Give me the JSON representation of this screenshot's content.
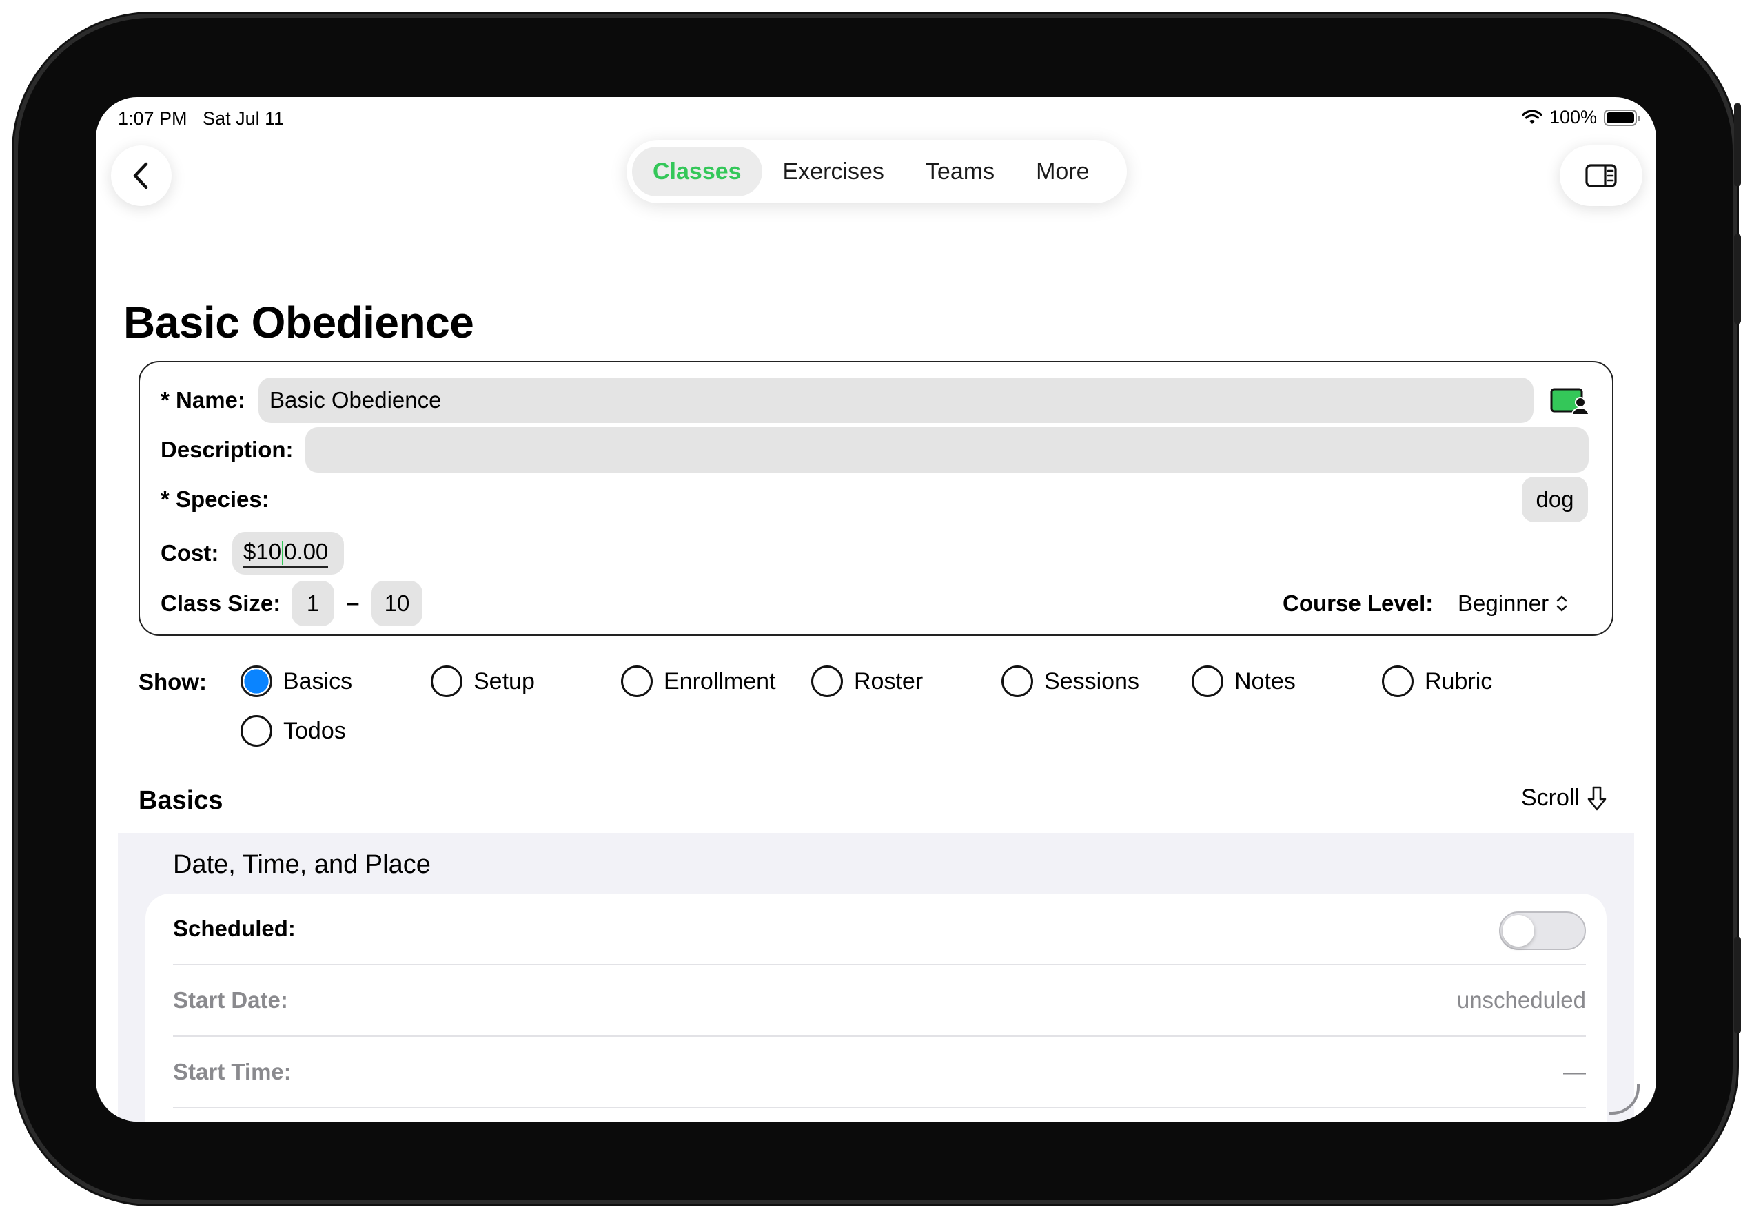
{
  "status_bar": {
    "time": "1:07 PM",
    "date": "Sat Jul 11",
    "battery_percent": "100%",
    "battery_level": 1.0
  },
  "nav": {
    "back_icon": "chevron-left-icon",
    "sidebar_icon": "sidebar-right-icon",
    "tabs": [
      {
        "label": "Classes",
        "active": true
      },
      {
        "label": "Exercises",
        "active": false
      },
      {
        "label": "Teams",
        "active": false
      },
      {
        "label": "More",
        "active": false
      }
    ],
    "accent_color": "#34c759"
  },
  "page": {
    "title": "Basic Obedience"
  },
  "form": {
    "name_label": "* Name:",
    "name_value": "Basic Obedience",
    "description_label": "Description:",
    "description_value": "",
    "species_label": "* Species:",
    "species_value": "dog",
    "cost_label": "Cost:",
    "cost_value_before_caret": "$10",
    "cost_value_after_caret": "0.00",
    "class_size_label": "Class Size:",
    "class_size_min": "1",
    "class_size_separator": "–",
    "class_size_max": "10",
    "course_level_label": "Course Level:",
    "course_level_value": "Beginner"
  },
  "show": {
    "label": "Show:",
    "options": [
      {
        "label": "Basics",
        "selected": true
      },
      {
        "label": "Setup",
        "selected": false
      },
      {
        "label": "Enrollment",
        "selected": false
      },
      {
        "label": "Roster",
        "selected": false
      },
      {
        "label": "Sessions",
        "selected": false
      },
      {
        "label": "Notes",
        "selected": false
      },
      {
        "label": "Rubric",
        "selected": false
      },
      {
        "label": "Todos",
        "selected": false
      }
    ],
    "selected_color": "#0a84ff"
  },
  "basics": {
    "title": "Basics",
    "scroll_label": "Scroll",
    "group_title": "Date, Time, and Place",
    "rows": [
      {
        "label": "Scheduled:",
        "toggle_on": false
      },
      {
        "label": "Start Date:",
        "value": "unscheduled"
      },
      {
        "label": "Start Time:",
        "value": "—"
      }
    ]
  }
}
